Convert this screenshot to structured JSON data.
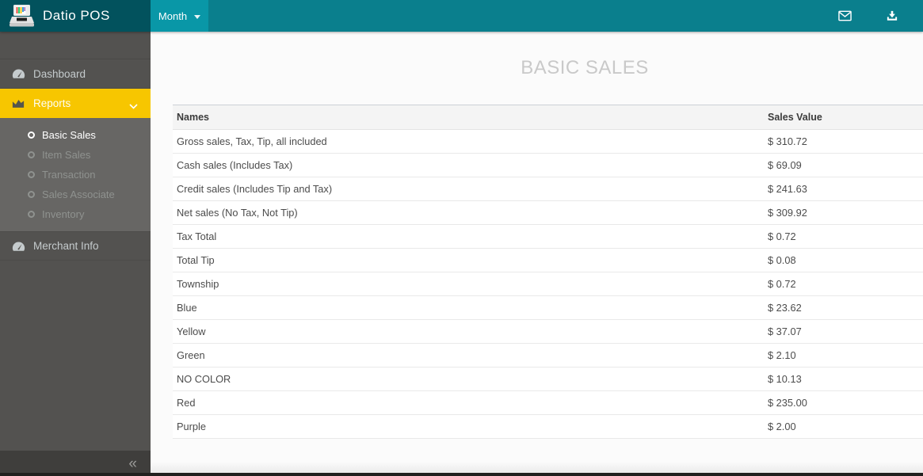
{
  "header": {
    "brand": "Datio POS",
    "period_label": "Month",
    "icons": {
      "logo": "cash-register-icon",
      "period_caret": "caret-down-icon",
      "mail": "envelope-icon",
      "export": "download-icon"
    }
  },
  "sidebar": {
    "items": [
      {
        "label": "Dashboard",
        "icon": "tachometer-icon",
        "active": false
      },
      {
        "label": "Reports",
        "icon": "area-chart-icon",
        "active": true,
        "expanded": true
      },
      {
        "label": "Merchant Info",
        "icon": "tachometer-icon",
        "active": false
      }
    ],
    "reports_submenu": [
      {
        "label": "Basic Sales",
        "icon": "circle-outline-icon",
        "active": true
      },
      {
        "label": "Item Sales",
        "icon": "circle-outline-icon",
        "active": false
      },
      {
        "label": "Transaction",
        "icon": "circle-outline-icon",
        "active": false
      },
      {
        "label": "Sales Associate",
        "icon": "circle-outline-icon",
        "active": false
      },
      {
        "label": "Inventory",
        "icon": "circle-outline-icon",
        "active": false
      }
    ],
    "collapse_glyph": "«"
  },
  "main": {
    "title": "BASIC SALES",
    "table": {
      "columns": [
        "Names",
        "Sales Value"
      ],
      "rows": [
        {
          "name": "Gross sales, Tax, Tip, all included",
          "value": "$ 310.72"
        },
        {
          "name": "Cash sales (Includes Tax)",
          "value": "$ 69.09"
        },
        {
          "name": "Credit sales (Includes Tip and Tax)",
          "value": "$ 241.63"
        },
        {
          "name": "Net sales (No Tax, Not Tip)",
          "value": "$ 309.92"
        },
        {
          "name": "Tax Total",
          "value": "$ 0.72"
        },
        {
          "name": "Total Tip",
          "value": "$ 0.08"
        },
        {
          "name": "Township",
          "value": "$ 0.72"
        },
        {
          "name": "Blue",
          "value": "$ 23.62"
        },
        {
          "name": "Yellow",
          "value": "$ 37.07"
        },
        {
          "name": "Green",
          "value": "$ 2.10"
        },
        {
          "name": "NO COLOR",
          "value": "$ 10.13"
        },
        {
          "name": "Red",
          "value": "$ 235.00"
        },
        {
          "name": "Purple",
          "value": "$ 2.00"
        }
      ]
    }
  },
  "colors": {
    "header_bar": "#0a7f8d",
    "header_brand_bg": "#02525d",
    "period_button_bg": "#0997a7",
    "sidebar_bg": "#535250",
    "submenu_bg": "#676664",
    "accent_yellow": "#f7c600",
    "title_text": "#c9c9c9"
  }
}
